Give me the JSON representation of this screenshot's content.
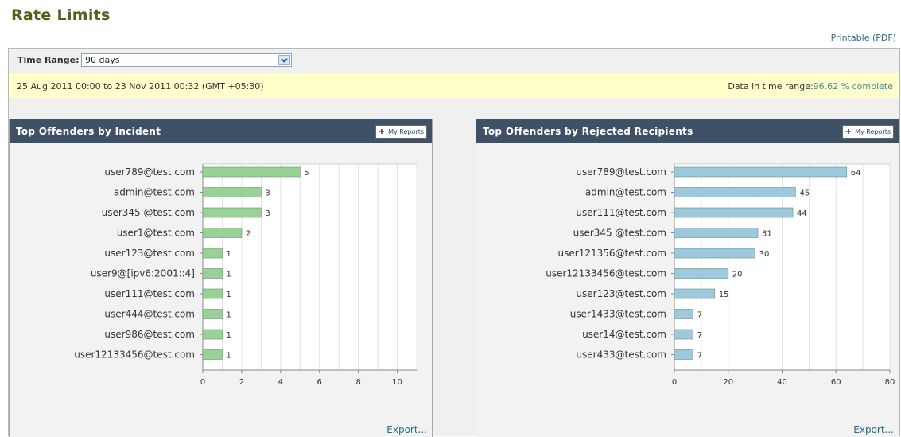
{
  "page": {
    "title": "Rate Limits",
    "printable_label": "Printable (PDF)"
  },
  "time_range": {
    "label": "Time Range:",
    "value": "90 days"
  },
  "date_range": {
    "text": "25 Aug 2011 00:00 to 23 Nov 2011 00:32 (GMT +05:30)",
    "complete_label": "Data in time range:",
    "complete_value": "96.62 % complete"
  },
  "colors": {
    "accent": "#3f5166",
    "bar_incident": "#98d295",
    "bar_rejected": "#9cc9dd",
    "highlight": "#ffffcc"
  },
  "panels": [
    {
      "title": "Top Offenders by Incident",
      "my_reports_label": "My Reports",
      "export_label": "Export..."
    },
    {
      "title": "Top Offenders by Rejected Recipients",
      "my_reports_label": "My Reports",
      "export_label": "Export..."
    }
  ],
  "chart_data": [
    {
      "type": "bar",
      "orientation": "horizontal",
      "categories": [
        "user789@test.com",
        "admin@test.com",
        "user345 @test.com",
        "user1@test.com",
        "user123@test.com",
        "user9@[ipv6:2001::4]",
        "user111@test.com",
        "user444@test.com",
        "user986@test.com",
        "user12133456@test.com"
      ],
      "values": [
        5,
        3,
        3,
        2,
        1,
        1,
        1,
        1,
        1,
        1
      ],
      "xlim": [
        0,
        11
      ],
      "xticks": [
        0,
        2,
        4,
        6,
        8,
        10
      ],
      "grid": true
    },
    {
      "type": "bar",
      "orientation": "horizontal",
      "categories": [
        "user789@test.com",
        "admin@test.com",
        "user111@test.com",
        "user345 @test.com",
        "user121356@test.com",
        "user12133456@test.com",
        "user123@test.com",
        "user1433@test.com",
        "user14@test.com",
        "user433@test.com"
      ],
      "values": [
        64,
        45,
        44,
        31,
        30,
        20,
        15,
        7,
        7,
        7
      ],
      "xlim": [
        0,
        80
      ],
      "xticks": [
        0,
        20,
        40,
        60,
        80
      ],
      "grid": true
    }
  ]
}
